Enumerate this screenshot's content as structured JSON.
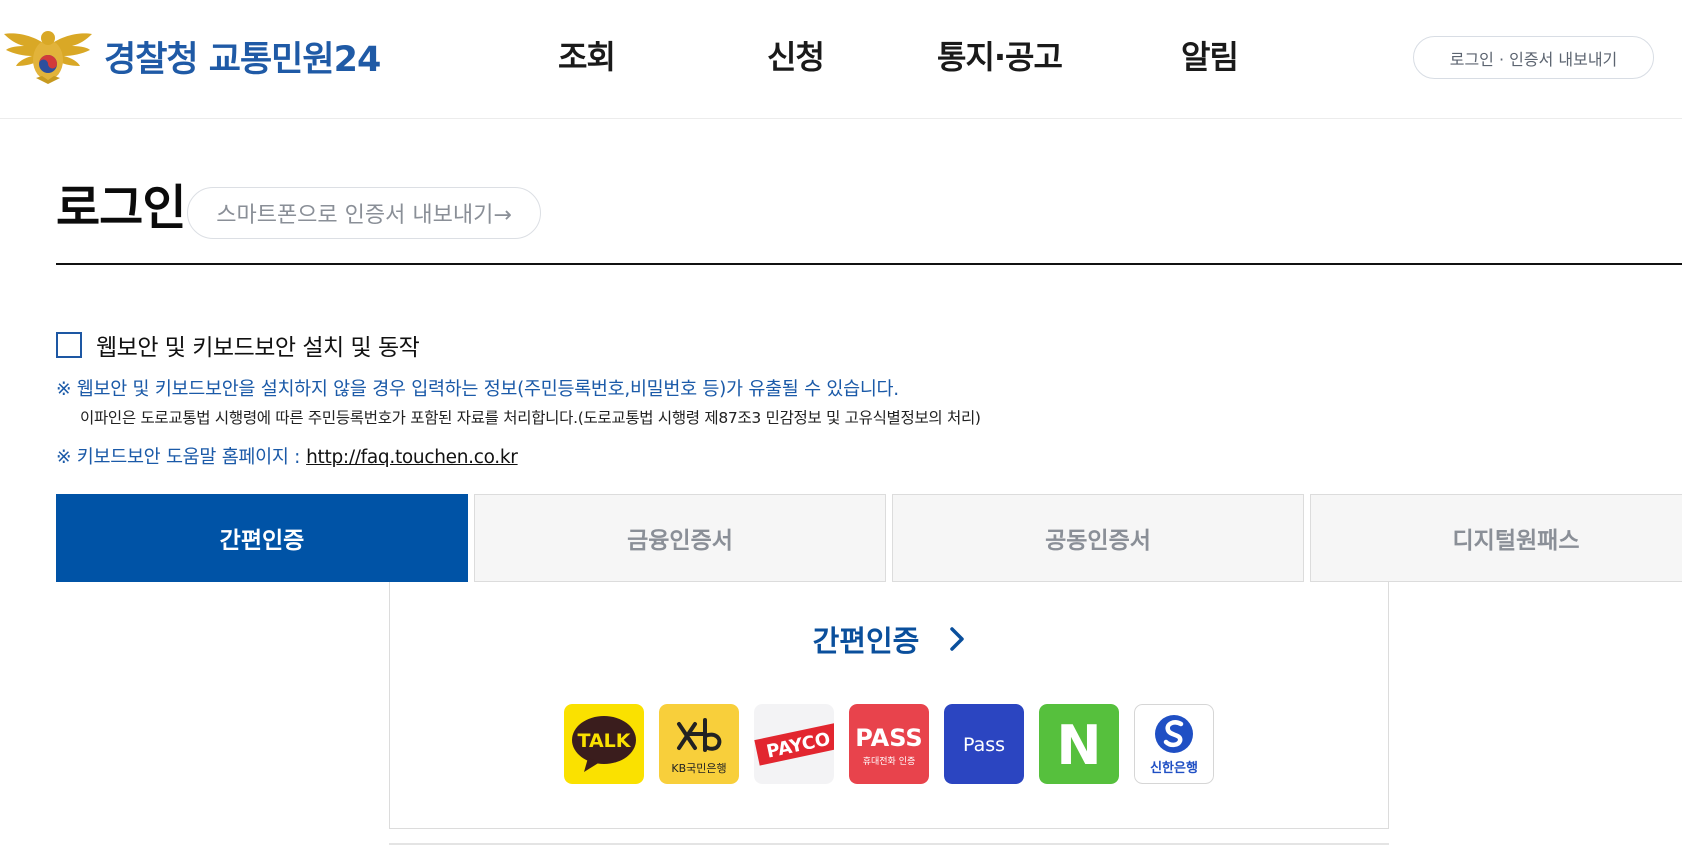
{
  "header": {
    "logo_text": "경찰청 교통민원24",
    "nav": [
      "조회",
      "신청",
      "통지·공고",
      "알림"
    ],
    "login_export_label": "로그인 · 인증서 내보내기"
  },
  "page": {
    "title": "로그인",
    "smartphone_export_label": "스마트폰으로 인증서 내보내기→"
  },
  "security": {
    "checkbox_label": "웹보안 및 키보드보안 설치 및 동작",
    "checked": false,
    "notice_1": "※ 웹보안 및 키보드보안을 설치하지 않을 경우 입력하는 정보(주민등록번호,비밀번호 등)가 유출될 수 있습니다.",
    "notice_2": "이파인은 도로교통법 시행령에 따른 주민등록번호가 포함된 자료를 처리합니다.(도로교통법 시행령 제87조3 민감정보 및 고유식별정보의 처리)",
    "notice_3_prefix": "※ 키보드보안 도움말 홈페이지 :",
    "notice_3_link": "http://faq.touchen.co.kr"
  },
  "tabs": [
    {
      "label": "간편인증",
      "active": true
    },
    {
      "label": "금융인증서",
      "active": false
    },
    {
      "label": "공동인증서",
      "active": false
    },
    {
      "label": "디지털원패스",
      "active": false
    }
  ],
  "panel": {
    "title": "간편인증",
    "providers": [
      {
        "name": "kakao-talk",
        "text": "TALK",
        "bg": "#fae100"
      },
      {
        "name": "kb-bank",
        "text": "KB국민은행",
        "bg": "#f8cf3b"
      },
      {
        "name": "payco",
        "text": "PAYCO",
        "bg": "#f3f3f5"
      },
      {
        "name": "pass-mobile",
        "text": "PASS",
        "subtext": "휴대전화 인증",
        "bg": "#e8434c"
      },
      {
        "name": "pass-samsung",
        "text": "Pass",
        "bg": "#2b45c1"
      },
      {
        "name": "naver",
        "text": "N",
        "bg": "#56c03d"
      },
      {
        "name": "shinhan",
        "text": "신한은행",
        "bg": "#ffffff"
      }
    ]
  },
  "colors": {
    "primary": "#0053a6",
    "logo": "#1f5aa6",
    "notice": "#1b5aa8"
  }
}
